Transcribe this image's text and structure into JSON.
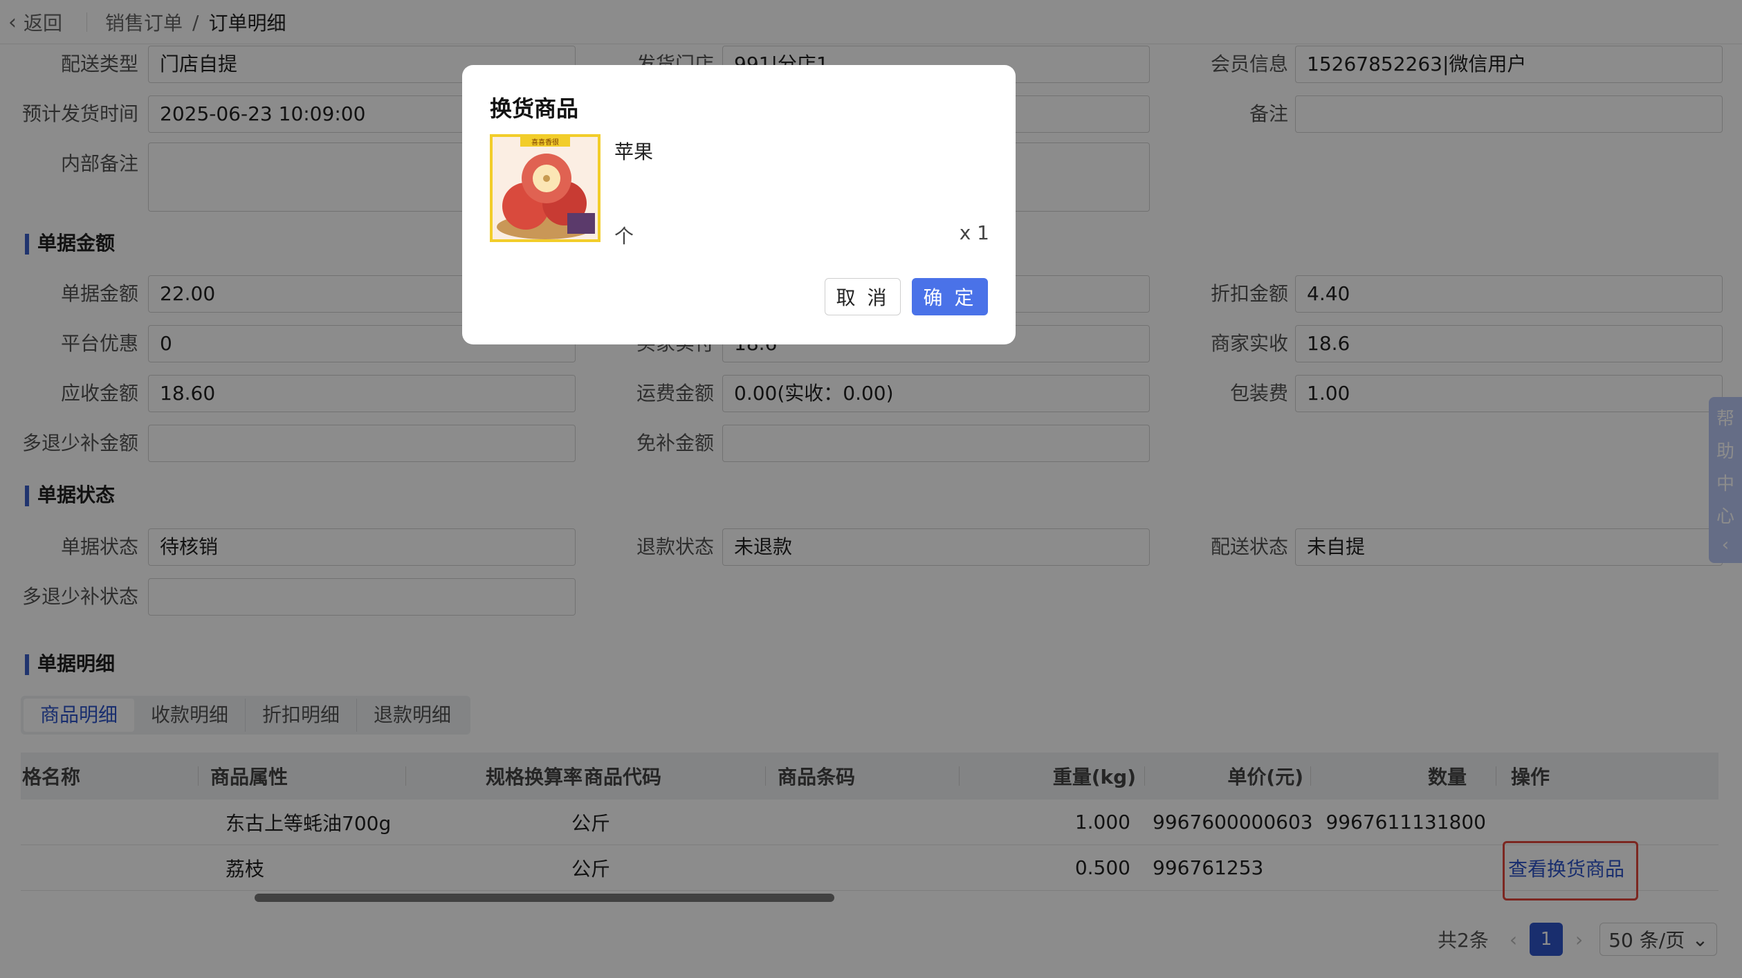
{
  "header": {
    "back_label": "返回",
    "crumb_parent": "销售订单",
    "crumb_sep": "/",
    "crumb_current": "订单明细"
  },
  "form_top": {
    "delivery_type_label": "配送类型",
    "delivery_type_value": "门店自提",
    "ship_store_label": "发货门店",
    "ship_store_value": "991|分店1",
    "member_label": "会员信息",
    "member_value": "15267852263|微信用户",
    "est_ship_time_label": "预计发货时间",
    "est_ship_time_value": "2025-06-23 10:09:00",
    "remark_label": "备注",
    "internal_remark_label": "内部备注"
  },
  "amount_section": {
    "title": "单据金额",
    "bill_amount_label": "单据金额",
    "bill_amount_value": "22.00",
    "discount_amount_label": "折扣金额",
    "discount_amount_value": "4.40",
    "platform_discount_label": "平台优惠",
    "platform_discount_value": "0",
    "customer_paid_label": "买家实付",
    "customer_paid_value": "18.6",
    "merchant_received_label": "商家实收",
    "merchant_received_value": "18.6",
    "receivable_label": "应收金额",
    "receivable_value": "18.60",
    "shipping_label": "运费金额",
    "shipping_value": "0.00(实收：0.00)",
    "packing_label": "包装费",
    "packing_value": "1.00",
    "over_refund_label": "多退少补金额",
    "waive_label": "免补金额"
  },
  "status_section": {
    "title": "单据状态",
    "bill_status_label": "单据状态",
    "bill_status_value": "待核销",
    "refund_status_label": "退款状态",
    "refund_status_value": "未退款",
    "delivery_status_label": "配送状态",
    "delivery_status_value": "未自提",
    "over_refund_status_label": "多退少补状态"
  },
  "detail_section": {
    "title": "单据明细",
    "tabs": [
      "商品明细",
      "收款明细",
      "折扣明细",
      "退款明细"
    ],
    "columns": {
      "spec_name": "格名称",
      "attr": "商品属性",
      "conv": "规格换算率",
      "code": "商品代码",
      "barcode": "商品条码",
      "weight": "重量(kg)",
      "price": "单价(元)",
      "qty": "数量",
      "ops": "操作"
    },
    "rows": [
      {
        "spec": "东古上等蚝油700g",
        "unit": "公斤",
        "weight": "1.000",
        "price": "9967600000603",
        "qty": "9967611131800",
        "op": ""
      },
      {
        "spec": "荔枝",
        "unit": "公斤",
        "weight": "0.500",
        "price": "996761253",
        "qty": "",
        "op": "查看换货商品"
      }
    ]
  },
  "pagination": {
    "total": "共2条",
    "current_page": "1",
    "page_size": "50 条/页"
  },
  "help": {
    "chars": [
      "帮",
      "助",
      "中",
      "心"
    ]
  },
  "modal": {
    "title": "换货商品",
    "image_banner": "喜喜香很",
    "product_name": "苹果",
    "unit": "个",
    "qty": "x 1",
    "cancel_label": "取 消",
    "ok_label": "确 定"
  }
}
